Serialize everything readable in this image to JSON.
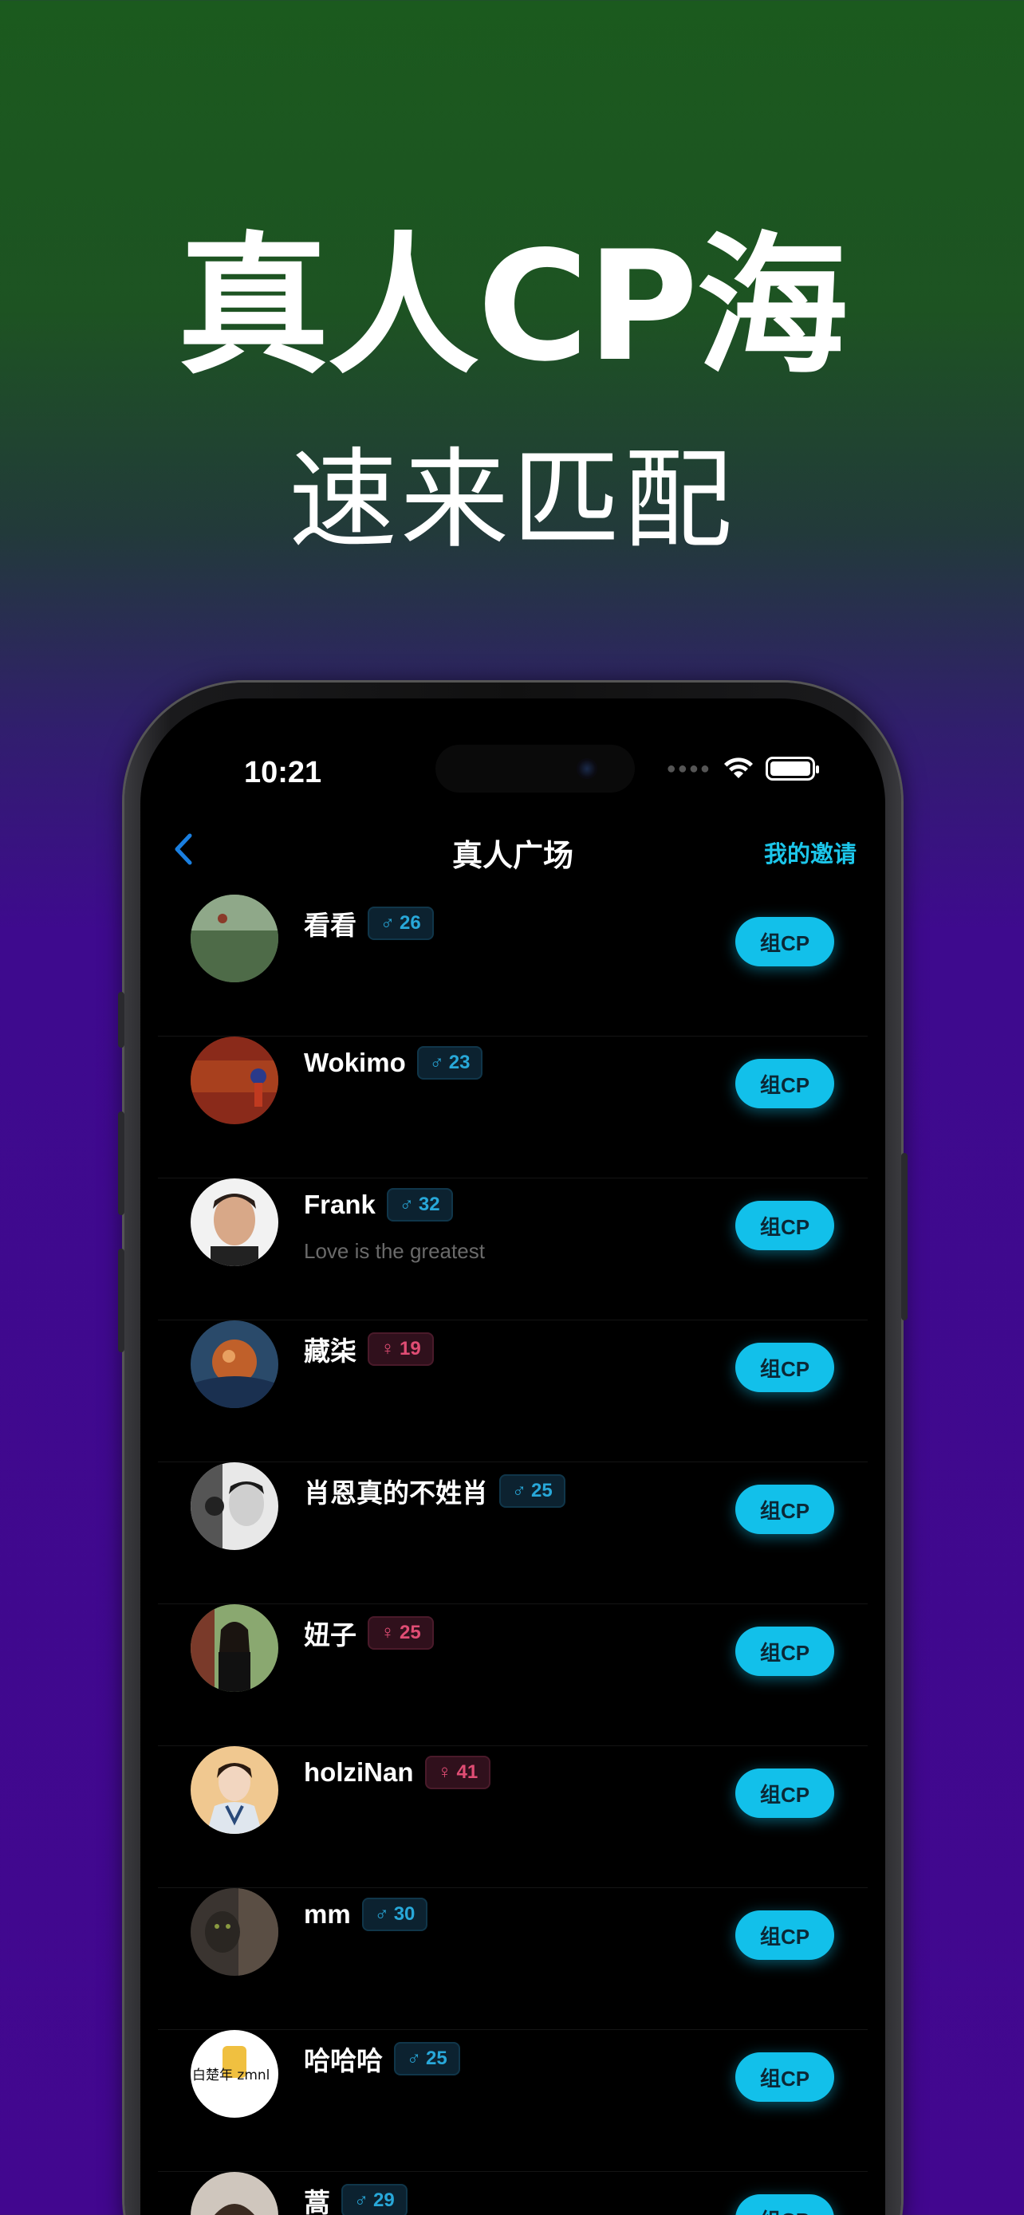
{
  "promo": {
    "headline": "真人CP海",
    "subline": "速来匹配"
  },
  "status_bar": {
    "time": "10:21"
  },
  "nav": {
    "title": "真人广场",
    "right_link": "我的邀请"
  },
  "colors": {
    "accent": "#12c0ea",
    "male": "#28a8d9",
    "female": "#e04d74"
  },
  "users": [
    {
      "name": "看看",
      "gender": "♂",
      "age": "26",
      "bio": "",
      "button": "组CP"
    },
    {
      "name": "Wokimo",
      "gender": "♂",
      "age": "23",
      "bio": "",
      "button": "组CP"
    },
    {
      "name": "Frank",
      "gender": "♂",
      "age": "32",
      "bio": "Love is the greatest",
      "button": "组CP"
    },
    {
      "name": "藏柒",
      "gender": "♀",
      "age": "19",
      "bio": "",
      "button": "组CP"
    },
    {
      "name": "肖恩真的不姓肖",
      "gender": "♂",
      "age": "25",
      "bio": "",
      "button": "组CP"
    },
    {
      "name": "妞子",
      "gender": "♀",
      "age": "25",
      "bio": "",
      "button": "组CP"
    },
    {
      "name": "holziNan",
      "gender": "♀",
      "age": "41",
      "bio": "",
      "button": "组CP"
    },
    {
      "name": "mm",
      "gender": "♂",
      "age": "30",
      "bio": "",
      "button": "组CP"
    },
    {
      "name": "哈哈哈",
      "gender": "♂",
      "age": "25",
      "bio": "",
      "button": "组CP"
    },
    {
      "name": "蒿",
      "gender": "♂",
      "age": "29",
      "bio": "",
      "button": "组CP"
    }
  ],
  "avatar_texts": {
    "hahaha_logo": "白楚年 zmnl"
  }
}
